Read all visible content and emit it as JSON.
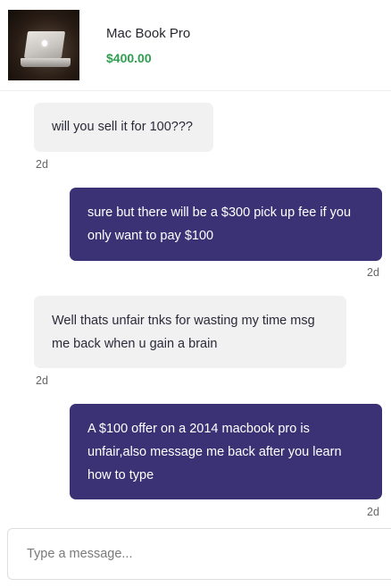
{
  "listing": {
    "title": "Mac Book Pro",
    "price": "$400.00"
  },
  "messages": [
    {
      "direction": "in",
      "text": "will you sell it for 100???",
      "time": "2d"
    },
    {
      "direction": "out",
      "text": "sure but there will be a $300 pick up fee if you only want to pay $100",
      "time": "2d"
    },
    {
      "direction": "in",
      "text": "Well thats unfair tnks for wasting my time msg me back when u gain a brain",
      "time": "2d"
    },
    {
      "direction": "out",
      "text": "A $100 offer on a 2014 macbook pro is unfair,also message me back after you learn how to type",
      "time": "2d"
    }
  ],
  "composer": {
    "placeholder": "Type a message..."
  },
  "colors": {
    "outgoing_bubble": "#3a3274",
    "incoming_bubble": "#f1f1f1",
    "price": "#2e9e4f"
  }
}
